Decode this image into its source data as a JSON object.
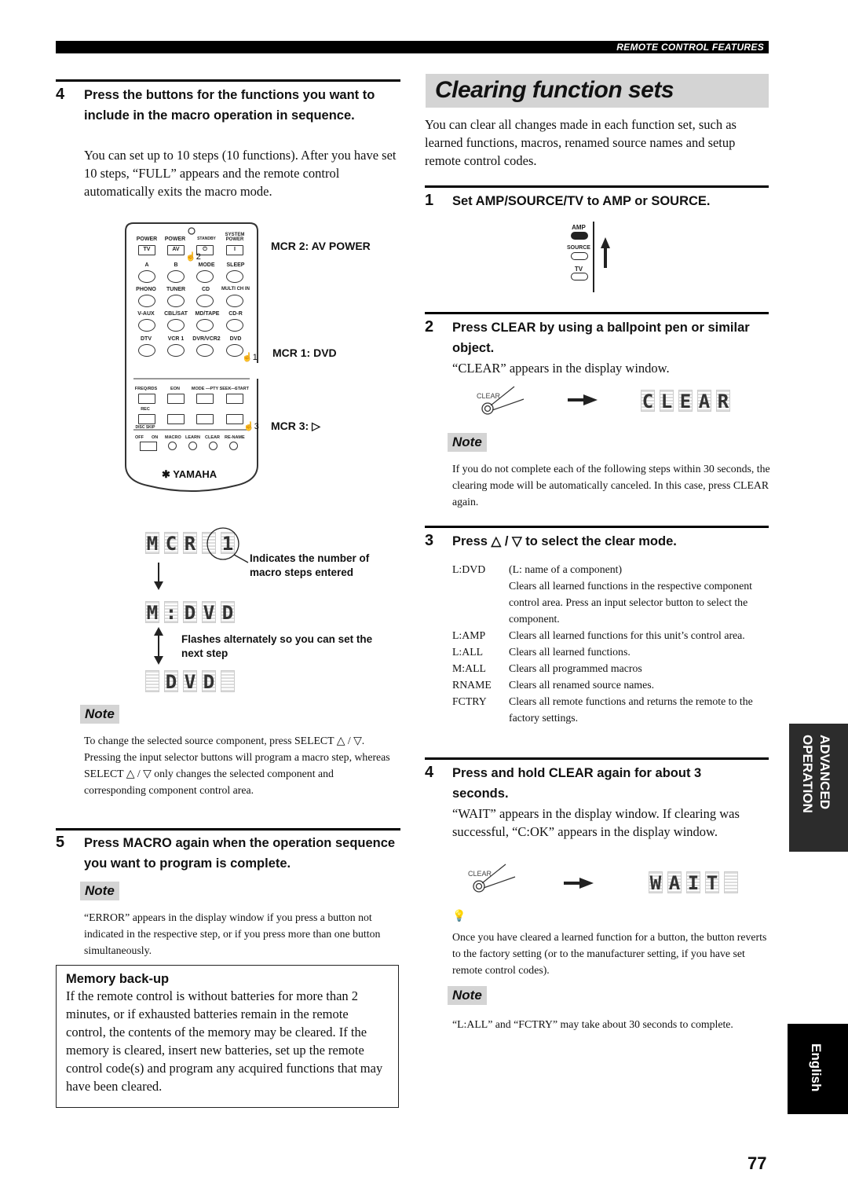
{
  "header": {
    "section_title": "REMOTE CONTROL FEATURES"
  },
  "left": {
    "step4": {
      "number": "4",
      "title": "Press the buttons for the functions you want to include in the macro operation in sequence.",
      "body": "You can set up to 10 steps (10 functions). After you have set 10 steps, “FULL” appears and the remote control automatically exits the macro mode."
    },
    "remote": {
      "row1_labels": [
        "POWER",
        "POWER",
        "STANDBY",
        "SYSTEM POWER"
      ],
      "row1_buttons": [
        "TV",
        "AV",
        "⏻",
        "I"
      ],
      "row2_labels": [
        "A",
        "B",
        "MODE",
        "SLEEP"
      ],
      "row3_labels": [
        "PHONO",
        "TUNER",
        "CD",
        "MULTI CH IN"
      ],
      "row4_labels": [
        "V-AUX",
        "CBL/SAT",
        "MD/TAPE",
        "CD-R"
      ],
      "row5_labels": [
        "DTV",
        "VCR 1",
        "DVR/VCR2",
        "DVD"
      ],
      "row6_labels": [
        "FREQ/RDS",
        "EON",
        "MODE —PTY SEEK—",
        "START"
      ],
      "row7_labels": [
        "REC",
        "",
        "",
        ""
      ],
      "disc_skip": "DISC SKIP",
      "row8_labels": [
        "OFF",
        "ON",
        "MACRO",
        "LEARN",
        "CLEAR",
        "RE-NAME"
      ],
      "brand": "YAMAHA",
      "hand_markers": [
        "2",
        "1",
        "3"
      ]
    },
    "callouts": {
      "mcr2": "MCR 2: AV POWER",
      "mcr1": "MCR 1: DVD",
      "mcr3": "MCR 3: ▷"
    },
    "display_sequence": {
      "frame1": [
        "M",
        "C",
        "R",
        "",
        "1"
      ],
      "frame2": [
        "M",
        ":",
        "D",
        "V",
        "D"
      ],
      "frame3": [
        "",
        "D",
        "V",
        "D",
        ""
      ],
      "annotation1": "Indicates the number of macro steps entered",
      "annotation2": "Flashes alternately so you can set the next step"
    },
    "note1": {
      "label": "Note",
      "text": "To change the selected source component, press SELECT △ / ▽. Pressing the input selector buttons will program a macro step, whereas SELECT △ / ▽ only changes the selected component and corresponding component control area."
    },
    "step5": {
      "number": "5",
      "title": "Press MACRO again when the operation sequence you want to program is complete."
    },
    "note2": {
      "label": "Note",
      "text": "“ERROR” appears in the display window if you press a button not indicated in the respective step, or if you press more than one button simultaneously."
    },
    "memory_box": {
      "title": "Memory back-up",
      "text": "If the remote control is without batteries for more than 2 minutes, or if exhausted batteries remain in the remote control, the contents of the memory may be cleared. If the memory is cleared, insert new batteries, set up the remote control code(s) and program any acquired functions that may have been cleared."
    }
  },
  "right": {
    "section_title": "Clearing function sets",
    "intro": "You can clear all changes made in each function set, such as learned functions, macros, renamed source names and setup remote control codes.",
    "step1": {
      "number": "1",
      "title": "Set AMP/SOURCE/TV to AMP or SOURCE.",
      "switch_positions": [
        "AMP",
        "SOURCE",
        "TV"
      ]
    },
    "step2": {
      "number": "2",
      "title": "Press CLEAR by using a ballpoint pen or similar object.",
      "body": "“CLEAR” appears in the display window.",
      "button_label": "CLEAR",
      "display": [
        "C",
        "L",
        "E",
        "A",
        "R"
      ]
    },
    "note3": {
      "label": "Note",
      "text": "If you do not complete each of the following steps within 30 seconds, the clearing mode will be automatically canceled. In this case, press CLEAR again."
    },
    "step3": {
      "number": "3",
      "title": "Press △ / ▽ to select the clear mode.",
      "modes": [
        {
          "key": "L:DVD",
          "desc": "(L: name of a component)"
        },
        {
          "key": "",
          "desc": "Clears all learned functions in the respective component control area. Press an input selector button to select the component."
        },
        {
          "key": "L:AMP",
          "desc": "Clears all learned functions for this unit’s control area."
        },
        {
          "key": "L:ALL",
          "desc": "Clears all learned functions."
        },
        {
          "key": "M:ALL",
          "desc": "Clears all programmed macros"
        },
        {
          "key": "RNAME",
          "desc": "Clears all renamed source names."
        },
        {
          "key": "FCTRY",
          "desc": "Clears all remote functions and returns the remote to the factory settings."
        }
      ]
    },
    "step4": {
      "number": "4",
      "title": "Press and hold CLEAR again for about 3 seconds.",
      "body": "“WAIT” appears in the display window. If clearing was successful, “C:OK” appears in the display window.",
      "button_label": "CLEAR",
      "display": [
        "W",
        "A",
        "I",
        "T",
        ""
      ]
    },
    "tip": {
      "icon": "tip-lightbulb-icon",
      "text": "Once you have cleared a learned function for a button, the button reverts to the factory setting (or to the manufacturer setting, if you have set remote control codes)."
    },
    "note4": {
      "label": "Note",
      "text": "“L:ALL” and “FCTRY” may take about 30 seconds to complete."
    }
  },
  "side_tabs": {
    "chapter_line1": "ADVANCED",
    "chapter_line2": "OPERATION",
    "language": "English"
  },
  "page_number": "77"
}
